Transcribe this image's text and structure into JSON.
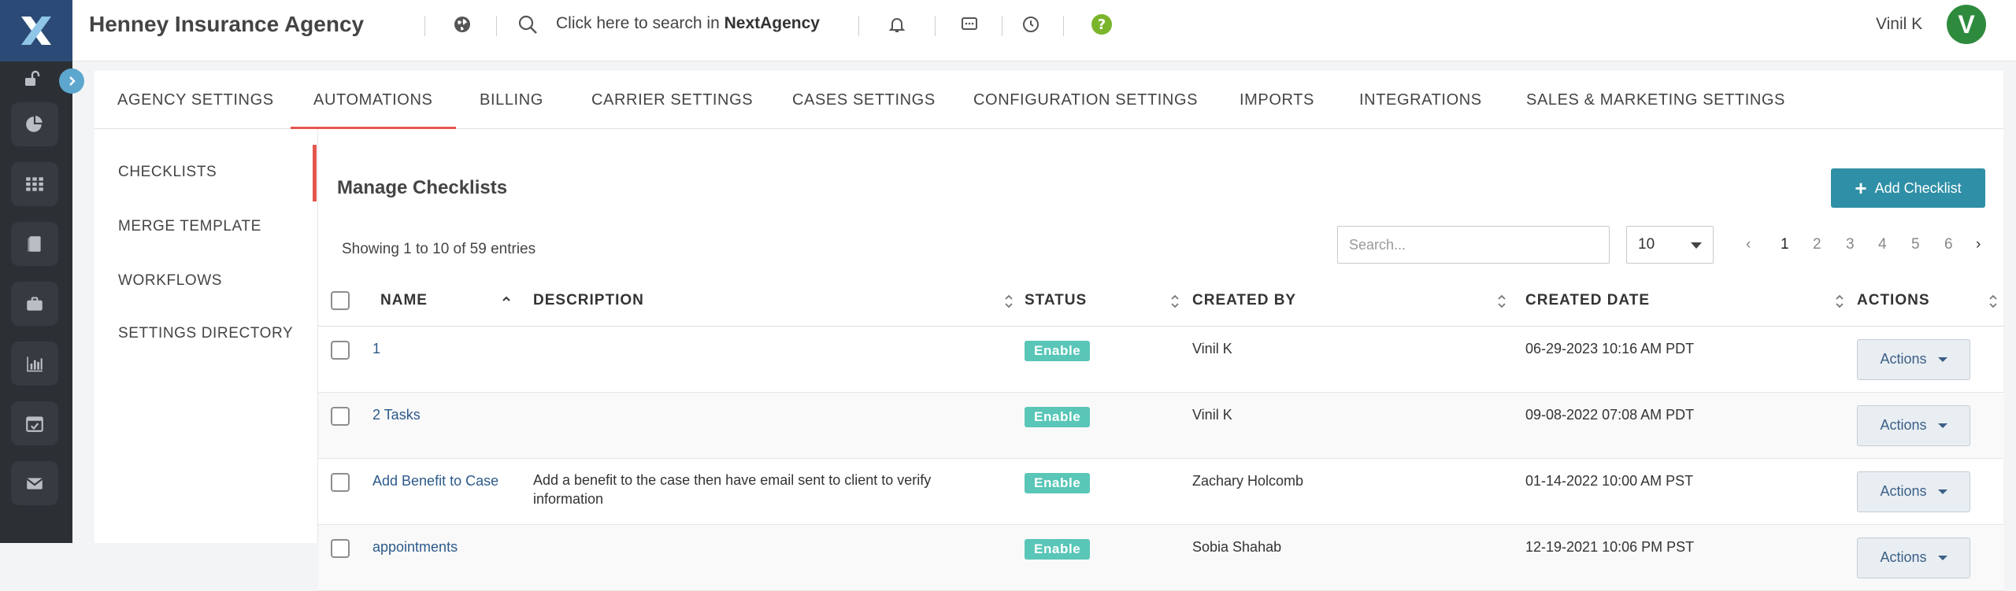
{
  "header": {
    "agency_name": "Henney Insurance Agency",
    "search_prefix": "Click here to search in",
    "search_brand": "NextAgency",
    "user_name": "Vinil K",
    "avatar_initial": "V",
    "colors": {
      "rail_bg": "#2c3035",
      "logo_bg": "#2b4b76",
      "avatar": "#2e8b3e",
      "help": "#7ab52c"
    }
  },
  "rail": {
    "icons": [
      "unlock-icon",
      "pie-chart-icon",
      "grid-icon",
      "book-icon",
      "briefcase-icon",
      "bar-chart-icon",
      "calendar-icon",
      "mail-icon"
    ]
  },
  "tabs": [
    {
      "label": "AGENCY SETTINGS",
      "active": false
    },
    {
      "label": "AUTOMATIONS",
      "active": true
    },
    {
      "label": "BILLING",
      "active": false
    },
    {
      "label": "CARRIER SETTINGS",
      "active": false
    },
    {
      "label": "CASES SETTINGS",
      "active": false
    },
    {
      "label": "CONFIGURATION SETTINGS",
      "active": false
    },
    {
      "label": "IMPORTS",
      "active": false
    },
    {
      "label": "INTEGRATIONS",
      "active": false
    },
    {
      "label": "SALES & MARKETING SETTINGS",
      "active": false
    }
  ],
  "subnav": [
    {
      "label": "CHECKLISTS",
      "active": true
    },
    {
      "label": "MERGE TEMPLATE",
      "active": false
    },
    {
      "label": "WORKFLOWS",
      "active": false
    },
    {
      "label": "SETTINGS DIRECTORY",
      "active": false
    }
  ],
  "content": {
    "title": "Manage Checklists",
    "add_button": "Add Checklist",
    "showing": "Showing 1 to 10 of 59 entries",
    "search_placeholder": "Search...",
    "page_size": "10",
    "pagination": {
      "prev": "‹",
      "pages": [
        "1",
        "2",
        "3",
        "4",
        "5",
        "6"
      ],
      "current": "1",
      "next": "›"
    }
  },
  "table": {
    "columns": [
      "NAME",
      "DESCRIPTION",
      "STATUS",
      "CREATED BY",
      "CREATED DATE",
      "ACTIONS"
    ],
    "rows": [
      {
        "name": "1",
        "description": "",
        "status": "Enable",
        "created_by": "Vinil K",
        "created_date": "06-29-2023 10:16 AM PDT",
        "action": "Actions"
      },
      {
        "name": "2 Tasks",
        "description": "",
        "status": "Enable",
        "created_by": "Vinil K",
        "created_date": "09-08-2022 07:08 AM PDT",
        "action": "Actions"
      },
      {
        "name": "Add Benefit to Case",
        "description": "Add a benefit to the case then have email sent to client to verify information",
        "status": "Enable",
        "created_by": "Zachary Holcomb",
        "created_date": "01-14-2022 10:00 AM PST",
        "action": "Actions"
      },
      {
        "name": "appointments",
        "description": "",
        "status": "Enable",
        "created_by": "Sobia Shahab",
        "created_date": "12-19-2021 10:06 PM PST",
        "action": "Actions"
      }
    ]
  }
}
